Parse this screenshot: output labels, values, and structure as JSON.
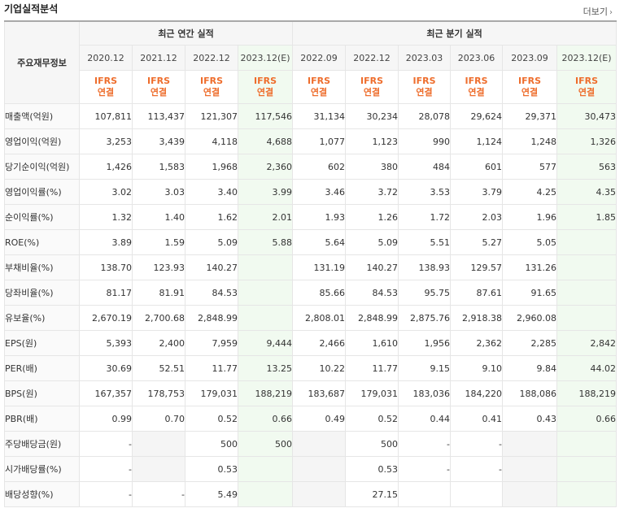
{
  "page": {
    "title": "기업실적분석",
    "more": "더보기"
  },
  "table": {
    "corner": "주요재무정보",
    "group_annual": "최근 연간 실적",
    "group_quarterly": "최근 분기 실적",
    "periods": [
      "2020.12",
      "2021.12",
      "2022.12",
      "2023.12(E)",
      "2022.09",
      "2022.12",
      "2023.03",
      "2023.06",
      "2023.09",
      "2023.12(E)"
    ],
    "standard_top": "IFRS",
    "standard_bottom": "연결",
    "estimate_columns": [
      3,
      9
    ],
    "rows": [
      {
        "label": "매출액(억원)",
        "values": [
          "107,811",
          "113,437",
          "121,307",
          "117,546",
          "31,134",
          "30,234",
          "28,078",
          "29,624",
          "29,371",
          "30,473"
        ]
      },
      {
        "label": "영업이익(억원)",
        "values": [
          "3,253",
          "3,439",
          "4,118",
          "4,688",
          "1,077",
          "1,123",
          "990",
          "1,124",
          "1,248",
          "1,326"
        ]
      },
      {
        "label": "당기순이익(억원)",
        "values": [
          "1,426",
          "1,583",
          "1,968",
          "2,360",
          "602",
          "380",
          "484",
          "601",
          "577",
          "563"
        ]
      },
      {
        "label": "영업이익률(%)",
        "values": [
          "3.02",
          "3.03",
          "3.40",
          "3.99",
          "3.46",
          "3.72",
          "3.53",
          "3.79",
          "4.25",
          "4.35"
        ]
      },
      {
        "label": "순이익률(%)",
        "values": [
          "1.32",
          "1.40",
          "1.62",
          "2.01",
          "1.93",
          "1.26",
          "1.72",
          "2.03",
          "1.96",
          "1.85"
        ]
      },
      {
        "label": "ROE(%)",
        "values": [
          "3.89",
          "1.59",
          "5.09",
          "5.88",
          "5.64",
          "5.09",
          "5.51",
          "5.27",
          "5.05",
          ""
        ]
      },
      {
        "label": "부채비율(%)",
        "values": [
          "138.70",
          "123.93",
          "140.27",
          "",
          "131.19",
          "140.27",
          "138.93",
          "129.57",
          "131.26",
          ""
        ]
      },
      {
        "label": "당좌비율(%)",
        "values": [
          "81.17",
          "81.91",
          "84.53",
          "",
          "85.66",
          "84.53",
          "95.75",
          "87.61",
          "91.65",
          ""
        ]
      },
      {
        "label": "유보율(%)",
        "values": [
          "2,670.19",
          "2,700.68",
          "2,848.99",
          "",
          "2,808.01",
          "2,848.99",
          "2,875.76",
          "2,918.38",
          "2,960.08",
          ""
        ]
      },
      {
        "label": "EPS(원)",
        "values": [
          "5,393",
          "2,400",
          "7,959",
          "9,444",
          "2,466",
          "1,610",
          "1,956",
          "2,362",
          "2,285",
          "2,842"
        ]
      },
      {
        "label": "PER(배)",
        "values": [
          "30.69",
          "52.51",
          "11.77",
          "13.25",
          "10.22",
          "11.77",
          "9.15",
          "9.10",
          "9.84",
          "44.02"
        ]
      },
      {
        "label": "BPS(원)",
        "values": [
          "167,357",
          "178,753",
          "179,031",
          "188,219",
          "183,687",
          "179,031",
          "183,036",
          "184,220",
          "188,086",
          "188,219"
        ]
      },
      {
        "label": "PBR(배)",
        "values": [
          "0.99",
          "0.70",
          "0.52",
          "0.66",
          "0.49",
          "0.52",
          "0.44",
          "0.41",
          "0.43",
          "0.66"
        ]
      },
      {
        "label": "주당배당금(원)",
        "values": [
          "-",
          "",
          "500",
          "500",
          "",
          "500",
          "-",
          "-",
          "",
          ""
        ]
      },
      {
        "label": "시가배당률(%)",
        "values": [
          "-",
          "",
          "0.53",
          "",
          "",
          "0.53",
          "-",
          "-",
          "",
          ""
        ]
      },
      {
        "label": "배당성향(%)",
        "values": [
          "-",
          "-",
          "5.49",
          "",
          "",
          "27.15",
          "",
          "",
          "",
          ""
        ]
      }
    ],
    "empty_cells": [
      [
        13,
        1
      ],
      [
        13,
        4
      ],
      [
        13,
        8
      ],
      [
        14,
        1
      ],
      [
        14,
        4
      ],
      [
        14,
        8
      ],
      [
        15,
        4
      ],
      [
        15,
        8
      ]
    ],
    "group_top_rows": [
      3,
      6,
      9,
      13
    ]
  },
  "colors": {
    "ifrs": "#ee6d2c",
    "estimate_bg": "#f1faf0"
  }
}
